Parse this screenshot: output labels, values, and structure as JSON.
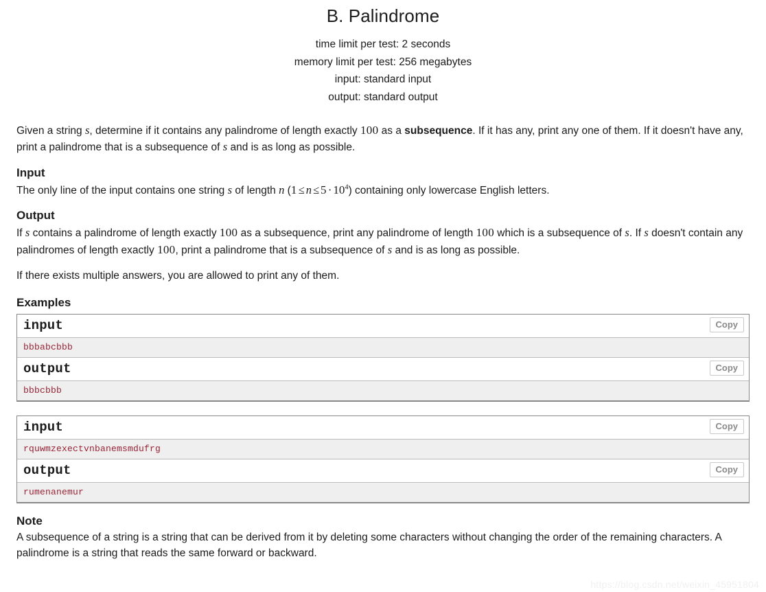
{
  "header": {
    "title": "B. Palindrome",
    "limits": [
      "time limit per test: 2 seconds",
      "memory limit per test: 256 megabytes",
      "input: standard input",
      "output: standard output"
    ]
  },
  "statement": {
    "part1": "Given a string ",
    "var_s1": "s",
    "part2": ", determine if it contains any palindrome of length exactly ",
    "num_100a": "100",
    "part3": " as a ",
    "bold_subsequence": "subsequence",
    "part4": ". If it has any, print any one of them. If it doesn't have any, print a palindrome that is a subsequence of ",
    "var_s2": "s",
    "part5": " and is as long as possible."
  },
  "input_section": {
    "heading": "Input",
    "text1": "The only line of the input contains one string ",
    "var_s": "s",
    "text2": " of length ",
    "var_n": "n",
    "text3": " (",
    "ineq_1": "1",
    "le1": "≤",
    "ineq_n": "n",
    "le2": "≤",
    "ineq_5": "5",
    "cdot": "·",
    "ineq_10": "10",
    "ineq_exp": "4",
    "text4": ") containing only lowercase English letters."
  },
  "output_section": {
    "heading": "Output",
    "t1": "If ",
    "s1": "s",
    "t2": " contains a palindrome of length exactly ",
    "n1": "100",
    "t3": " as a subsequence, print any palindrome of length ",
    "n2": "100",
    "t4": " which is a subsequence of ",
    "s2": "s",
    "t5": ". If ",
    "s3": "s",
    "t6": " doesn't contain any palindromes of length exactly ",
    "n3": "100",
    "t7": ", print a palindrome that is a subsequence of ",
    "s4": "s",
    "t8": " and is as long as possible.",
    "para2": "If there exists multiple answers, you are allowed to print any of them."
  },
  "examples": {
    "heading": "Examples",
    "copy_label": "Copy",
    "input_label": "input",
    "output_label": "output",
    "tests": [
      {
        "input": "bbbabcbbb",
        "output": "bbbcbbb"
      },
      {
        "input": "rquwmzexectvnbanemsmdufrg",
        "output": "rumenanemur"
      }
    ]
  },
  "note": {
    "heading": "Note",
    "text": "A subsequence of a string is a string that can be derived from it by deleting some characters without changing the order of the remaining characters. A palindrome is a string that reads the same forward or backward."
  },
  "watermark": "https://blog.csdn.net/weixin_45951804",
  "colors": {
    "sample_text": "#9b2335",
    "sample_bg": "#efefef",
    "border": "#888888",
    "copy_text": "#8a8a8a"
  }
}
